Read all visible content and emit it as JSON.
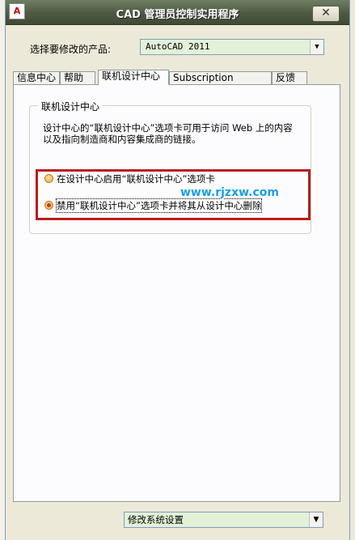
{
  "window": {
    "title": "CAD 管理员控制实用程序",
    "close_label": "✕",
    "app_icon_text": "A"
  },
  "product": {
    "label": "选择要修改的产品:",
    "selected": "AutoCAD 2011"
  },
  "tabs": [
    {
      "label": "信息中心",
      "active": false
    },
    {
      "label": "帮助",
      "active": false
    },
    {
      "label": "联机设计中心",
      "active": true
    },
    {
      "label": "Subscription Center",
      "active": false
    },
    {
      "label": "反馈",
      "active": false
    }
  ],
  "group": {
    "title": "联机设计中心",
    "description": "设计中心的“联机设计中心”选项卡可用于访问 Web 上的内容以及指向制造商和内容集成商的链接。",
    "options": [
      {
        "label": "在设计中心启用“联机设计中心”选项卡",
        "checked": false
      },
      {
        "label": "禁用“联机设计中心”选项卡并将其从设计中心删除",
        "checked": true
      }
    ]
  },
  "watermark": "www.rjzxw.com",
  "footer": {
    "selected": "修改系统设置"
  },
  "colors": {
    "highlight_border": "#b81c1c",
    "title_bar": "#4d5a41",
    "select_bg": "#e3f1d9"
  }
}
